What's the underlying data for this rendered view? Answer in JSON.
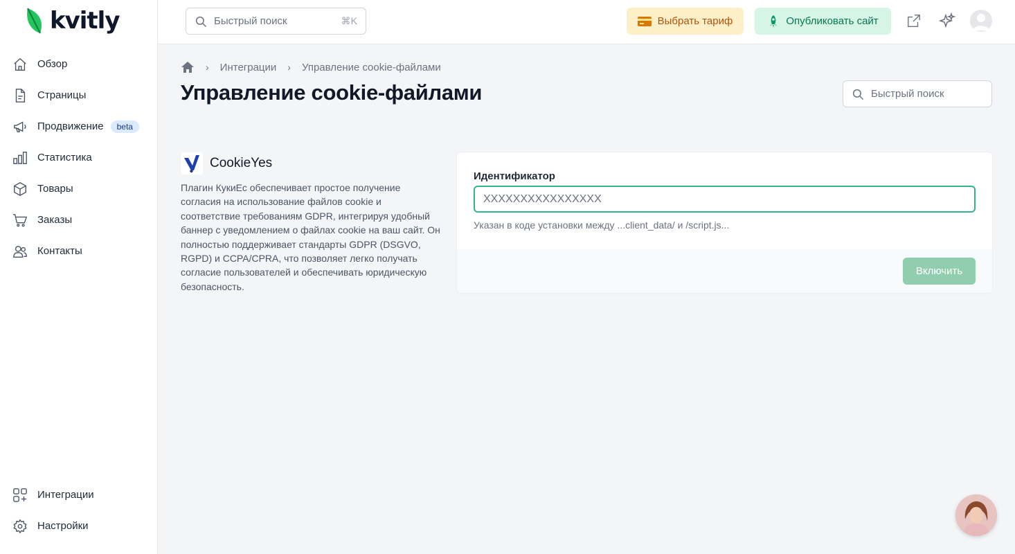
{
  "app": {
    "logo_text": "kvitly",
    "brand_color": "#16a34a"
  },
  "sidebar": {
    "items": [
      {
        "label": "Обзор",
        "icon": "home-icon"
      },
      {
        "label": "Страницы",
        "icon": "page-icon"
      },
      {
        "label": "Продвижение",
        "icon": "megaphone-icon",
        "badge": "beta"
      },
      {
        "label": "Статистика",
        "icon": "bar-chart-icon"
      },
      {
        "label": "Товары",
        "icon": "box-icon"
      },
      {
        "label": "Заказы",
        "icon": "cart-icon"
      },
      {
        "label": "Контакты",
        "icon": "users-icon"
      }
    ],
    "bottom_items": [
      {
        "label": "Интеграции",
        "icon": "apps-plus-icon"
      },
      {
        "label": "Настройки",
        "icon": "gear-icon"
      }
    ]
  },
  "topbar": {
    "search_placeholder": "Быстрый поиск",
    "search_shortcut": "⌘K",
    "plan_button": "Выбрать тариф",
    "publish_button": "Опубликовать сайт"
  },
  "breadcrumb": {
    "items": [
      "Интеграции",
      "Управление cookie-файлами"
    ]
  },
  "page": {
    "title": "Управление cookie-файлами",
    "search_placeholder": "Быстрый поиск"
  },
  "plugin": {
    "name": "CookieYes",
    "description": "Плагин КукиЕс обеспечивает простое получение согласия на использование файлов cookie и соответствие требованиям GDPR, интегрируя удобный баннер с уведомлением о файлах cookie на ваш сайт. Он полностью поддерживает стандарты GDPR (DSGVO, RGPD) и CCPA/CPRA, что позволяет легко получать согласие пользователей и обеспечивать юридическую безопасность."
  },
  "form": {
    "label": "Идентификатор",
    "placeholder": "XXXXXXXXXXXXXXXX",
    "hint": "Указан в коде установки между ...client_data/ и /script.js...",
    "submit": "Включить"
  }
}
